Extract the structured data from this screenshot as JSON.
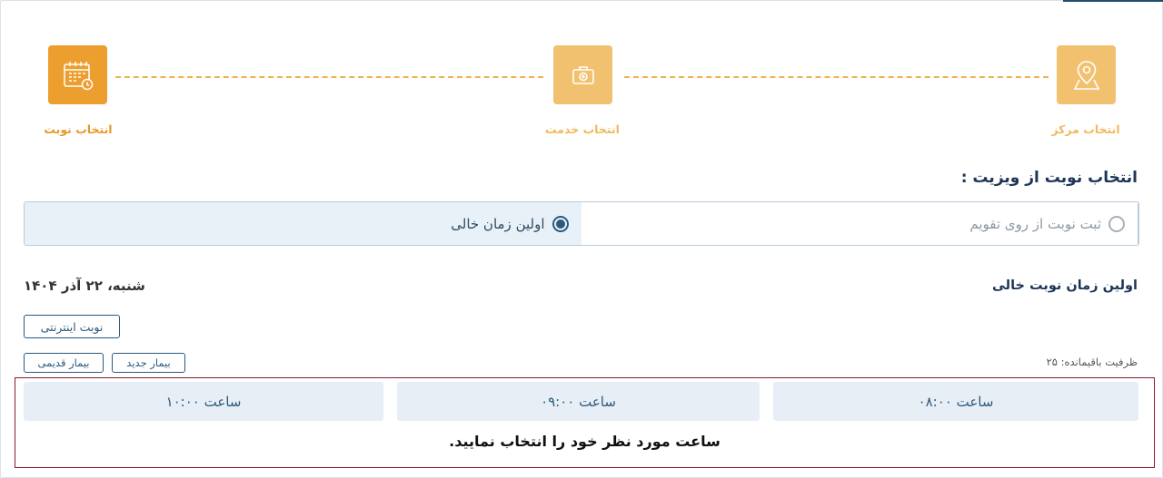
{
  "stepper": {
    "steps": [
      {
        "label": "انتخاب مرکز",
        "icon": "map-pin-icon",
        "state": "inactive"
      },
      {
        "label": "انتخاب خدمت",
        "icon": "medical-kit-icon",
        "state": "inactive"
      },
      {
        "label": "انتخاب نوبت",
        "icon": "calendar-icon",
        "state": "active"
      }
    ]
  },
  "section_title": "انتخاب نوبت از ویزیت :",
  "mode": {
    "first_free": "اولین زمان خالی",
    "calendar": "ثبت نوبت از روی تقویم",
    "selected": "first_free"
  },
  "first_slot_title": "اولین زمان نوبت خالی",
  "date_text": "شنبه، ۲۲ آذر ۱۴۰۴",
  "internet_appointment": "نوبت اینترنتی",
  "patient_types": {
    "new": "بیمار جدید",
    "old": "بیمار قدیمی"
  },
  "capacity_text": "ظرفیت باقیمانده: ۲۵",
  "slots": [
    "ساعت ۰۸:۰۰",
    "ساعت ۰۹:۰۰",
    "ساعت ۱۰:۰۰"
  ],
  "hint": "ساعت مورد نظر خود را انتخاب نمایید.",
  "colors": {
    "accent_active": "#ec9f2f",
    "accent_inactive": "#f2c16f",
    "primary": "#2b5a7e",
    "slot_bg": "#e7eef6",
    "error_border": "#8a1a2b"
  }
}
